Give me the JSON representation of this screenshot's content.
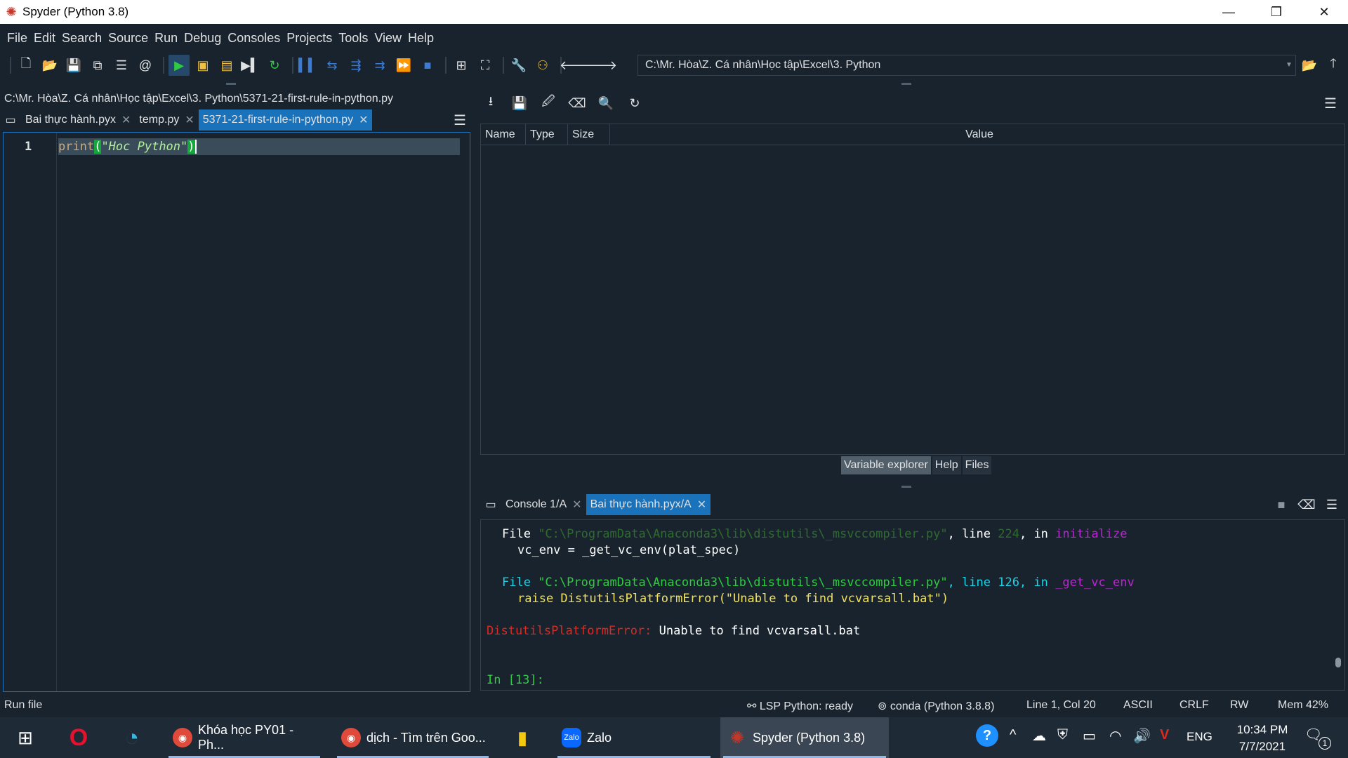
{
  "window": {
    "title": "Spyder (Python 3.8)"
  },
  "menu": [
    "File",
    "Edit",
    "Search",
    "Source",
    "Run",
    "Debug",
    "Consoles",
    "Projects",
    "Tools",
    "View",
    "Help"
  ],
  "toolbar": {
    "working_dir": "C:\\Mr. Hòa\\Z. Cá nhân\\Học tập\\Excel\\3. Python"
  },
  "editor": {
    "file_path": "C:\\Mr. Hòa\\Z. Cá nhân\\Học tập\\Excel\\3. Python\\5371-21-first-rule-in-python.py",
    "tabs": [
      {
        "label": "Bai thực hành.pyx"
      },
      {
        "label": "temp.py"
      },
      {
        "label": "5371-21-first-rule-in-python.py"
      }
    ],
    "line_number": "1",
    "code": {
      "func": "print",
      "open": "(",
      "string": "\"Hoc Python\"",
      "close": ")"
    }
  },
  "variable_explorer": {
    "columns": [
      "Name",
      "Type",
      "Size",
      "Value"
    ],
    "tabs": [
      "Variable explorer",
      "Help",
      "Files"
    ]
  },
  "console": {
    "tabs": [
      "Console 1/A",
      "Bai thực hành.pyx/A"
    ],
    "lines": {
      "l1_file": "File ",
      "l1_path": "\"C:\\ProgramData\\Anaconda3\\lib\\distutils\\_msvccompiler.py\"",
      "l1_comma": ", ",
      "l1_line": "line ",
      "l1_num": "224",
      "l1_in": ", in ",
      "l1_func": "initialize",
      "l2": "vc_env = _get_vc_env(plat_spec)",
      "l3_file": "File ",
      "l3_path": "\"C:\\ProgramData\\Anaconda3\\lib\\distutils\\_msvccompiler.py\"",
      "l3_rest": ", line 126, in ",
      "l3_func": "_get_vc_env",
      "l4": "raise DistutilsPlatformError(\"Unable to find vcvarsall.bat\")",
      "l5_err": "DistutilsPlatformError:",
      "l5_msg": " Unable to find vcvarsall.bat",
      "prompt": "In [13]:"
    }
  },
  "statusbar": {
    "left": "Run file",
    "lsp": "LSP Python: ready",
    "conda": "conda (Python 3.8.8)",
    "position": "Line 1, Col 20",
    "encoding": "ASCII",
    "eol": "CRLF",
    "mode": "RW",
    "mem": "Mem 42%"
  },
  "taskbar": {
    "apps": [
      {
        "label": "Khóa học PY01 - Ph..."
      },
      {
        "label": "dịch - Tìm trên Goo..."
      },
      {
        "label": "Zalo"
      },
      {
        "label": "Spyder (Python 3.8)"
      }
    ],
    "zalo_icon_text": "Zalo",
    "lang": "ENG",
    "time": "10:34 PM",
    "date": "7/7/2021",
    "notification_count": "1"
  }
}
